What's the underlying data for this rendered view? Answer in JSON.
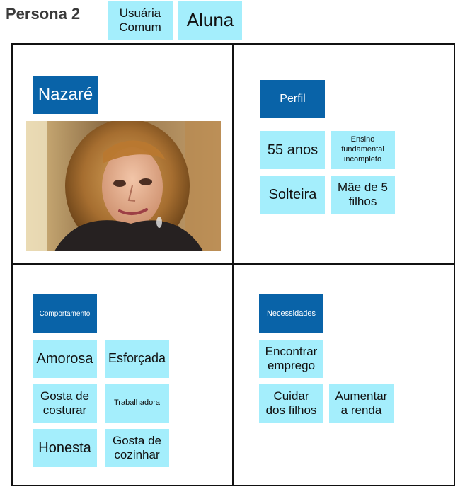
{
  "header": {
    "title": "Persona 2",
    "tags": [
      "Usuária\nComum",
      "Aluna"
    ]
  },
  "persona": {
    "name": "Nazaré"
  },
  "profile": {
    "title": "Perfil",
    "items": [
      "55 anos",
      "Ensino\nfundamental\nincompleto",
      "Solteira",
      "Mãe de 5\nfilhos"
    ]
  },
  "behavior": {
    "title": "Comportamento",
    "items": [
      "Amorosa",
      "Esforçada",
      "Gosta de\ncosturar",
      "Trabalhadora",
      "Honesta",
      "Gosta de\ncozinhar"
    ]
  },
  "needs": {
    "title": "Necessidades",
    "items": [
      "Encontrar\nemprego",
      "Cuidar\ndos filhos",
      "Aumentar\na renda"
    ]
  },
  "colors": {
    "note": "#a4eefc",
    "tag": "#0963a8",
    "text": "#111111",
    "title": "#3a3a3a"
  }
}
